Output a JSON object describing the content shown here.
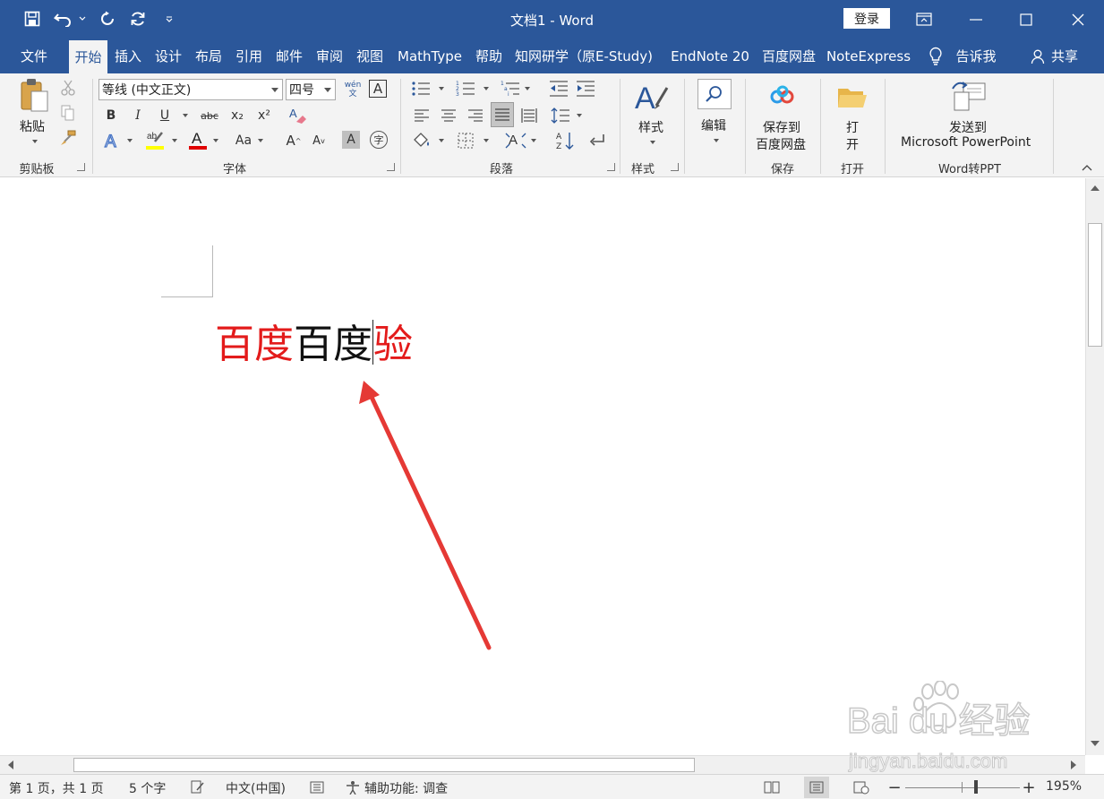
{
  "titlebar": {
    "title": "文档1  -  Word",
    "login": "登录"
  },
  "tabs": [
    {
      "label": "文件",
      "active": false
    },
    {
      "label": "开始",
      "active": true
    },
    {
      "label": "插入",
      "active": false
    },
    {
      "label": "设计",
      "active": false
    },
    {
      "label": "布局",
      "active": false
    },
    {
      "label": "引用",
      "active": false
    },
    {
      "label": "邮件",
      "active": false
    },
    {
      "label": "审阅",
      "active": false
    },
    {
      "label": "视图",
      "active": false
    },
    {
      "label": "MathType",
      "active": false
    },
    {
      "label": "帮助",
      "active": false
    },
    {
      "label": "知网研学（原E-Study)",
      "active": false
    },
    {
      "label": "EndNote 20",
      "active": false
    },
    {
      "label": "百度网盘",
      "active": false
    },
    {
      "label": "NoteExpress",
      "active": false
    },
    {
      "label": "告诉我",
      "active": false
    },
    {
      "label": "共享",
      "active": false
    }
  ],
  "ribbon": {
    "clipboard": {
      "paste": "粘贴",
      "group": "剪贴板"
    },
    "font": {
      "name": "等线 (中文正文)",
      "size": "四号",
      "phonetic": "wén\n文",
      "border_char": "A",
      "bold": "B",
      "italic": "I",
      "underline": "U",
      "strike": "abc",
      "sub": "x₂",
      "sup": "x²",
      "change_case": "Aa",
      "grow": "A",
      "shrink": "A",
      "shading": "A",
      "enclose": "字",
      "group": "字体"
    },
    "paragraph": {
      "group": "段落"
    },
    "styles": {
      "label": "样式",
      "group": "样式"
    },
    "editing": {
      "label": "编辑"
    },
    "save": {
      "line1": "保存到",
      "line2": "百度网盘",
      "group": "保存"
    },
    "open": {
      "line1": "打",
      "line2": "开",
      "group": "打开"
    },
    "ppt": {
      "line1": "发送到",
      "line2": "Microsoft PowerPoint",
      "group": "Word转PPT"
    }
  },
  "document": {
    "text_red_1": "百度",
    "text_black": "百度",
    "text_red_2": "验"
  },
  "colors": {
    "accent": "#2b579a",
    "red_text": "#e31b1b",
    "arrow": "#e53935"
  },
  "watermark": {
    "line1": "Bai du 经验",
    "line2": "jingyan.baidu.com"
  },
  "statusbar": {
    "page": "第 1 页，共 1 页",
    "words": "5 个字",
    "language": "中文(中国)",
    "accessibility": "辅助功能: 调查",
    "zoom": "195%",
    "zoom_slider_fraction": 0.62
  }
}
